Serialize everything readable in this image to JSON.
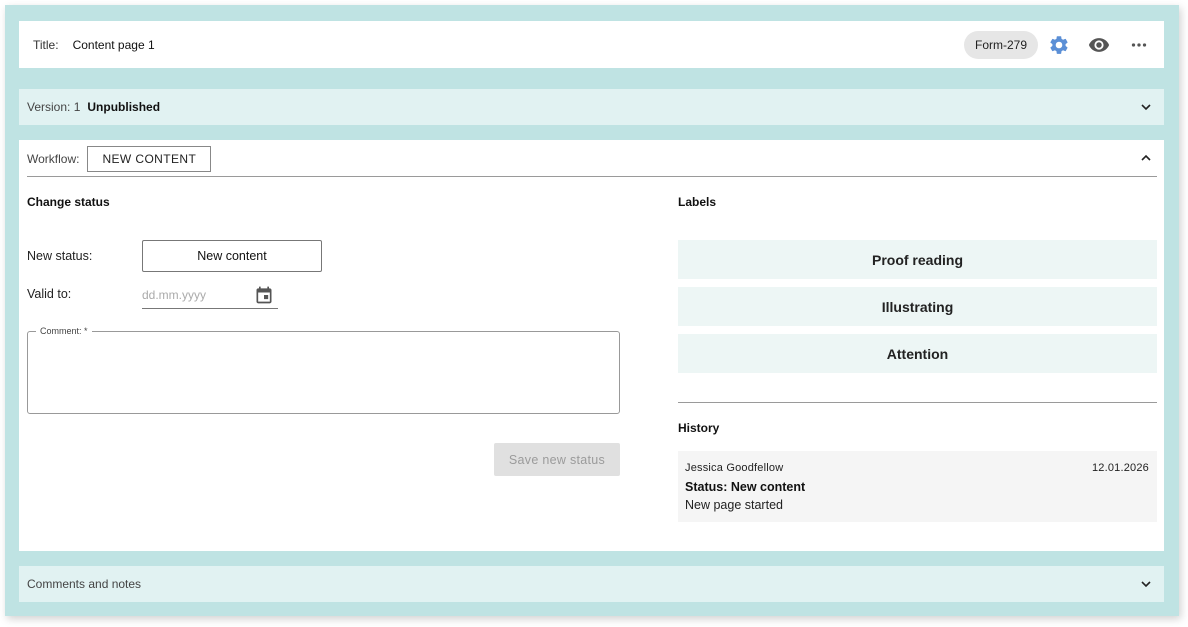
{
  "header": {
    "title_label": "Title:",
    "title_value": "Content page 1",
    "form_badge": "Form-279",
    "icons": [
      "gear-icon",
      "eye-icon",
      "more-icon"
    ],
    "accent_color": "#5b8fd6"
  },
  "version": {
    "label": "Version: 1",
    "status": "Unpublished"
  },
  "workflow": {
    "label": "Workflow:",
    "current": "NEW CONTENT",
    "change_status": {
      "title": "Change status",
      "new_status_label": "New status:",
      "new_status_value": "New content",
      "valid_to_label": "Valid to:",
      "valid_to_placeholder": "dd.mm.yyyy",
      "comment_label": "Comment: *",
      "save_button": "Save new status"
    },
    "labels": {
      "title": "Labels",
      "items": [
        "Proof reading",
        "Illustrating",
        "Attention"
      ]
    },
    "history": {
      "title": "History",
      "entries": [
        {
          "user": "Jessica Goodfellow",
          "date": "12.01.2026",
          "status": "Status: New content",
          "note": "New page started"
        }
      ]
    }
  },
  "comments_section": {
    "label": "Comments and notes"
  },
  "colors": {
    "frame_bg": "#bfe3e3",
    "strip_bg": "#e1f2f2",
    "label_bg": "#edf6f5"
  }
}
